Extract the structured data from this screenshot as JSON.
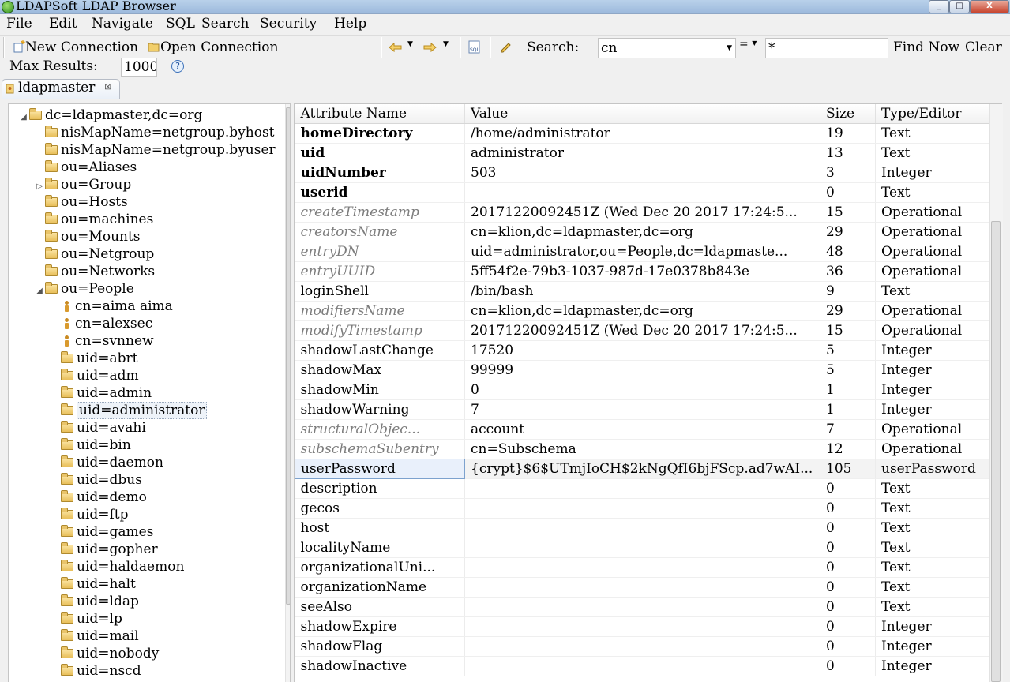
{
  "window": {
    "title": "LDAPSoft LDAP Browser",
    "min": "_",
    "max": "□",
    "close": "X"
  },
  "menu": [
    "File",
    "Edit",
    "Navigate",
    "SQL",
    "Search",
    "Security",
    "Help"
  ],
  "toolbar": {
    "new_connection": "New Connection",
    "open_connection": "Open Connection",
    "search_label": "Search:",
    "search_attribute": "cn",
    "operator": "=",
    "search_value": "*",
    "find_now": "Find Now",
    "clear": "Clear",
    "max_results_label": "Max Results:",
    "max_results_value": "1000",
    "help_glyph": "?"
  },
  "tab": {
    "label": "ldapmaster",
    "close": "⊠"
  },
  "tree": [
    {
      "label": "dc=ldapmaster,dc=org",
      "depth": 0,
      "kind": "folder",
      "expander": "◢"
    },
    {
      "label": "nisMapName=netgroup.byhost",
      "depth": 1,
      "kind": "folder",
      "expander": ""
    },
    {
      "label": "nisMapName=netgroup.byuser",
      "depth": 1,
      "kind": "folder",
      "expander": ""
    },
    {
      "label": "ou=Aliases",
      "depth": 1,
      "kind": "folder",
      "expander": ""
    },
    {
      "label": "ou=Group",
      "depth": 1,
      "kind": "folder",
      "expander": "▷"
    },
    {
      "label": "ou=Hosts",
      "depth": 1,
      "kind": "folder",
      "expander": ""
    },
    {
      "label": "ou=machines",
      "depth": 1,
      "kind": "folder",
      "expander": ""
    },
    {
      "label": "ou=Mounts",
      "depth": 1,
      "kind": "folder",
      "expander": ""
    },
    {
      "label": "ou=Netgroup",
      "depth": 1,
      "kind": "folder",
      "expander": ""
    },
    {
      "label": "ou=Networks",
      "depth": 1,
      "kind": "folder",
      "expander": ""
    },
    {
      "label": "ou=People",
      "depth": 1,
      "kind": "folder",
      "expander": "◢"
    },
    {
      "label": "cn=aima aima",
      "depth": 2,
      "kind": "person",
      "expander": ""
    },
    {
      "label": "cn=alexsec",
      "depth": 2,
      "kind": "person",
      "expander": ""
    },
    {
      "label": "cn=svnnew",
      "depth": 2,
      "kind": "person",
      "expander": ""
    },
    {
      "label": "uid=abrt",
      "depth": 2,
      "kind": "folder",
      "expander": ""
    },
    {
      "label": "uid=adm",
      "depth": 2,
      "kind": "folder",
      "expander": ""
    },
    {
      "label": "uid=admin",
      "depth": 2,
      "kind": "folder",
      "expander": ""
    },
    {
      "label": "uid=administrator",
      "depth": 2,
      "kind": "folder",
      "expander": "",
      "selected": true
    },
    {
      "label": "uid=avahi",
      "depth": 2,
      "kind": "folder",
      "expander": ""
    },
    {
      "label": "uid=bin",
      "depth": 2,
      "kind": "folder",
      "expander": ""
    },
    {
      "label": "uid=daemon",
      "depth": 2,
      "kind": "folder",
      "expander": ""
    },
    {
      "label": "uid=dbus",
      "depth": 2,
      "kind": "folder",
      "expander": ""
    },
    {
      "label": "uid=demo",
      "depth": 2,
      "kind": "folder",
      "expander": ""
    },
    {
      "label": "uid=ftp",
      "depth": 2,
      "kind": "folder",
      "expander": ""
    },
    {
      "label": "uid=games",
      "depth": 2,
      "kind": "folder",
      "expander": ""
    },
    {
      "label": "uid=gopher",
      "depth": 2,
      "kind": "folder",
      "expander": ""
    },
    {
      "label": "uid=haldaemon",
      "depth": 2,
      "kind": "folder",
      "expander": ""
    },
    {
      "label": "uid=halt",
      "depth": 2,
      "kind": "folder",
      "expander": ""
    },
    {
      "label": "uid=ldap",
      "depth": 2,
      "kind": "folder",
      "expander": ""
    },
    {
      "label": "uid=lp",
      "depth": 2,
      "kind": "folder",
      "expander": ""
    },
    {
      "label": "uid=mail",
      "depth": 2,
      "kind": "folder",
      "expander": ""
    },
    {
      "label": "uid=nobody",
      "depth": 2,
      "kind": "folder",
      "expander": ""
    },
    {
      "label": "uid=nscd",
      "depth": 2,
      "kind": "folder",
      "expander": ""
    }
  ],
  "table": {
    "columns": [
      "Attribute Name",
      "Value",
      "Size",
      "Type/Editor"
    ],
    "rows": [
      {
        "name": "homeDirectory",
        "value": "/home/administrator",
        "size": "19",
        "type": "Text",
        "style": "bold"
      },
      {
        "name": "uid",
        "value": "administrator",
        "size": "13",
        "type": "Text",
        "style": "bold"
      },
      {
        "name": "uidNumber",
        "value": "503",
        "size": "3",
        "type": "Integer",
        "style": "bold"
      },
      {
        "name": "userid",
        "value": "",
        "size": "0",
        "type": "Text",
        "style": "bold"
      },
      {
        "name": "createTimestamp",
        "value": "20171220092451Z (Wed Dec 20 2017 17:24:5...",
        "size": "15",
        "type": "Operational",
        "style": "op"
      },
      {
        "name": "creatorsName",
        "value": "cn=klion,dc=ldapmaster,dc=org",
        "size": "29",
        "type": "Operational",
        "style": "op"
      },
      {
        "name": "entryDN",
        "value": "uid=administrator,ou=People,dc=ldapmaste...",
        "size": "48",
        "type": "Operational",
        "style": "op"
      },
      {
        "name": "entryUUID",
        "value": "5ff54f2e-79b3-1037-987d-17e0378b843e",
        "size": "36",
        "type": "Operational",
        "style": "op"
      },
      {
        "name": "loginShell",
        "value": "/bin/bash",
        "size": "9",
        "type": "Text",
        "style": "normal"
      },
      {
        "name": "modifiersName",
        "value": "cn=klion,dc=ldapmaster,dc=org",
        "size": "29",
        "type": "Operational",
        "style": "op"
      },
      {
        "name": "modifyTimestamp",
        "value": "20171220092451Z (Wed Dec 20 2017 17:24:5...",
        "size": "15",
        "type": "Operational",
        "style": "op"
      },
      {
        "name": "shadowLastChange",
        "value": "17520",
        "size": "5",
        "type": "Integer",
        "style": "normal"
      },
      {
        "name": "shadowMax",
        "value": "99999",
        "size": "5",
        "type": "Integer",
        "style": "normal"
      },
      {
        "name": "shadowMin",
        "value": "0",
        "size": "1",
        "type": "Integer",
        "style": "normal"
      },
      {
        "name": "shadowWarning",
        "value": "7",
        "size": "1",
        "type": "Integer",
        "style": "normal"
      },
      {
        "name": "structuralObjec...",
        "value": "account",
        "size": "7",
        "type": "Operational",
        "style": "op"
      },
      {
        "name": "subschemaSubentry",
        "value": "cn=Subschema",
        "size": "12",
        "type": "Operational",
        "style": "op"
      },
      {
        "name": "userPassword",
        "value": "{crypt}$6$UTmjIoCH$2kNgQfI6bjFScp.ad7wAI...",
        "size": "105",
        "type": "userPassword",
        "style": "normal",
        "selected": true
      },
      {
        "name": "description",
        "value": "",
        "size": "0",
        "type": "Text",
        "style": "normal"
      },
      {
        "name": "gecos",
        "value": "",
        "size": "0",
        "type": "Text",
        "style": "normal"
      },
      {
        "name": "host",
        "value": "",
        "size": "0",
        "type": "Text",
        "style": "normal"
      },
      {
        "name": "localityName",
        "value": "",
        "size": "0",
        "type": "Text",
        "style": "normal"
      },
      {
        "name": "organizationalUni...",
        "value": "",
        "size": "0",
        "type": "Text",
        "style": "normal"
      },
      {
        "name": "organizationName",
        "value": "",
        "size": "0",
        "type": "Text",
        "style": "normal"
      },
      {
        "name": "seeAlso",
        "value": "",
        "size": "0",
        "type": "Text",
        "style": "normal"
      },
      {
        "name": "shadowExpire",
        "value": "",
        "size": "0",
        "type": "Integer",
        "style": "normal"
      },
      {
        "name": "shadowFlag",
        "value": "",
        "size": "0",
        "type": "Integer",
        "style": "normal"
      },
      {
        "name": "shadowInactive",
        "value": "",
        "size": "0",
        "type": "Integer",
        "style": "normal"
      }
    ]
  }
}
